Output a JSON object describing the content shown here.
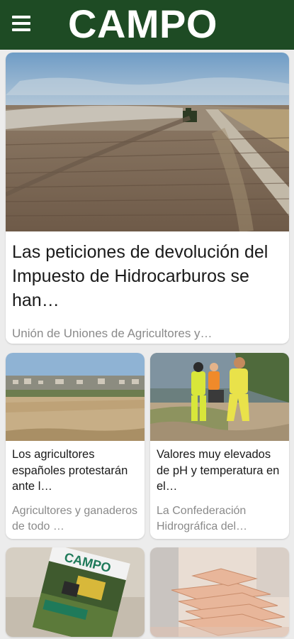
{
  "header": {
    "logo_text": "CAMPO",
    "background_color": "#1e4b24",
    "menu_icon": "hamburger-menu-icon"
  },
  "feed": {
    "lead": {
      "title": "Las peticiones de devolución del Impuesto de Hidrocarburos se han…",
      "source": "Unión de Uniones de Agricultores y…"
    },
    "cards": [
      {
        "title": "Los agricultores españoles protestarán ante l…",
        "source": "Agricultores y ganaderos de todo …"
      },
      {
        "title": "Valores muy elevados de pH y temperatura en el…",
        "source": "La Confederación Hidrográfica del…"
      }
    ],
    "magazine_cover": {
      "title": "CAMPO"
    }
  }
}
